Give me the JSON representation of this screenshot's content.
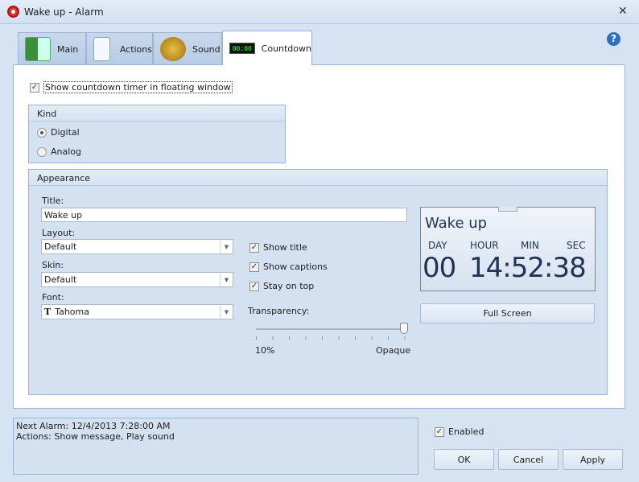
{
  "window": {
    "title": "Wake up - Alarm",
    "close": "✕"
  },
  "tabs": [
    {
      "label": "Main"
    },
    {
      "label": "Actions"
    },
    {
      "label": "Sound"
    },
    {
      "label": "Countdown",
      "icon_text": "00:00"
    }
  ],
  "help": "?",
  "show_floating": {
    "label": "Show countdown timer in floating window",
    "checked": true
  },
  "kind": {
    "header": "Kind",
    "options": [
      {
        "label": "Digital",
        "selected": true
      },
      {
        "label": "Analog",
        "selected": false
      }
    ]
  },
  "appearance": {
    "header": "Appearance",
    "title_label": "Title:",
    "title_value": "Wake up",
    "layout_label": "Layout:",
    "layout_value": "Default",
    "skin_label": "Skin:",
    "skin_value": "Default",
    "font_label": "Font:",
    "font_value": "Tahoma",
    "checks": [
      {
        "label": "Show title",
        "checked": true
      },
      {
        "label": "Show captions",
        "checked": true
      },
      {
        "label": "Stay on top",
        "checked": true
      }
    ],
    "transparency_label": "Transparency:",
    "transparency_min": "10%",
    "transparency_max": "Opaque",
    "transparency_value_percent": 100,
    "full_screen": "Full Screen"
  },
  "preview": {
    "title": "Wake up",
    "captions": [
      "DAY",
      "HOUR",
      "MIN",
      "SEC"
    ],
    "day": "00",
    "time": "14:52:38"
  },
  "status": {
    "line1": "Next Alarm: 12/4/2013 7:28:00 AM",
    "line2": "Actions: Show message, Play sound"
  },
  "enabled": {
    "label": "Enabled",
    "checked": true
  },
  "buttons": {
    "ok": "OK",
    "cancel": "Cancel",
    "apply": "Apply"
  }
}
